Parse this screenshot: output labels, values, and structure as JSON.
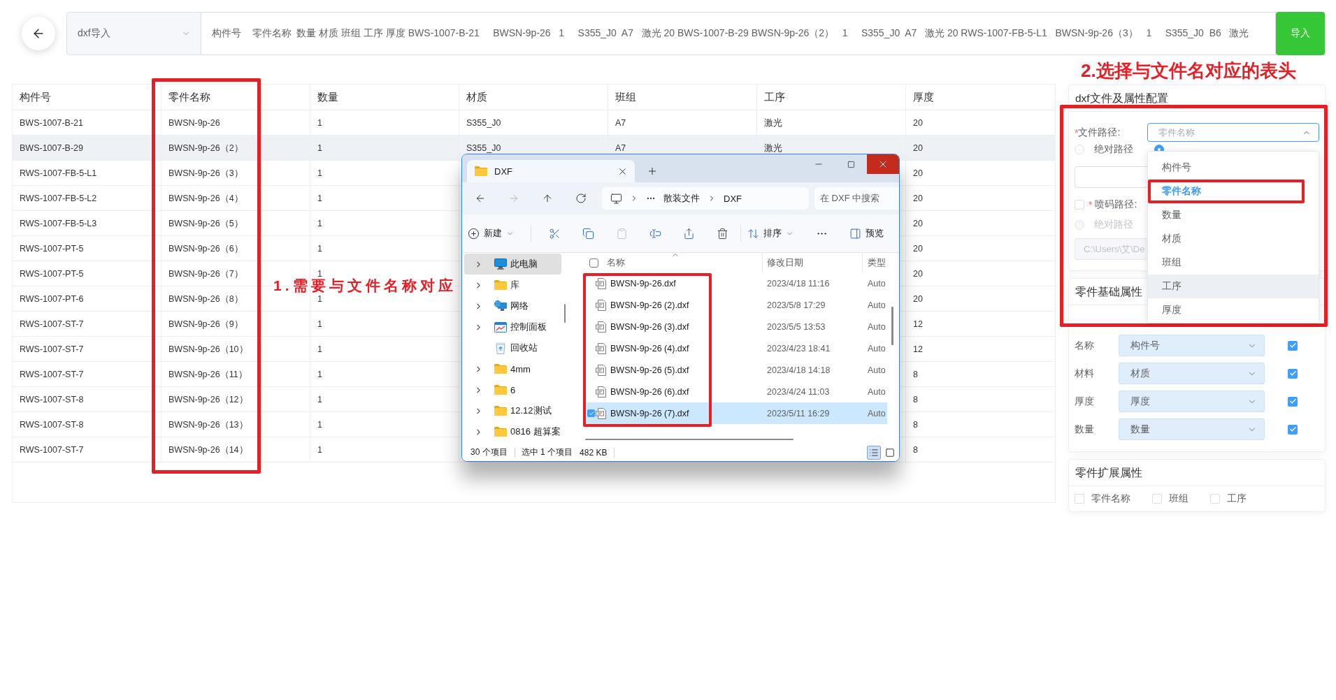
{
  "top_bar": {
    "import_type": {
      "value": "dxf导入"
    },
    "paste_field": {
      "value": "构件号    零件名称  数量 材质 班组 工序 厚度 BWS-1007-B-21     BWSN-9p-26   1     S355_J0  A7   激光 20 BWS-1007-B-29 BWSN-9p-26（2）   1     S355_J0  A7   激光 20 RWS-1007-FB-5-L1   BWSN-9p-26（3）   1     S355_J0  B6   激光"
    },
    "import_button": {
      "label": "导入"
    }
  },
  "annotations": [
    {
      "kind": "panel",
      "text": "2.选择与文件名对应的表头"
    },
    {
      "kind": "table",
      "text": "1.需要与文件名称对应"
    }
  ],
  "table": {
    "columns": [
      "构件号",
      "零件名称",
      "数量",
      "材质",
      "班组",
      "工序",
      "厚度"
    ],
    "rows": [
      {
        "hovered": false,
        "cells": {
          "component_no": "BWS-1007-B-21",
          "part_name": "BWSN-9p-26",
          "quantity": "1",
          "material": "S355_J0",
          "team": "A7",
          "process": "激光",
          "thickness": "20"
        }
      },
      {
        "hovered": true,
        "cells": {
          "component_no": "BWS-1007-B-29",
          "part_name": "BWSN-9p-26（2）",
          "quantity": "1",
          "material": "S355_J0",
          "team": "A7",
          "process": "激光",
          "thickness": "20"
        }
      },
      {
        "hovered": false,
        "cells": {
          "component_no": "RWS-1007-FB-5-L1",
          "part_name": "BWSN-9p-26（3）",
          "quantity": "1",
          "thickness": "20"
        }
      },
      {
        "hovered": false,
        "cells": {
          "component_no": "RWS-1007-FB-5-L2",
          "part_name": "BWSN-9p-26（4）",
          "quantity": "1",
          "thickness": "20"
        }
      },
      {
        "hovered": false,
        "cells": {
          "component_no": "RWS-1007-FB-5-L3",
          "part_name": "BWSN-9p-26（5）",
          "quantity": "1",
          "thickness": "20"
        }
      },
      {
        "hovered": false,
        "cells": {
          "component_no": "RWS-1007-PT-5",
          "part_name": "BWSN-9p-26（6）",
          "quantity": "1",
          "thickness": "20"
        }
      },
      {
        "hovered": false,
        "cells": {
          "component_no": "RWS-1007-PT-5",
          "part_name": "BWSN-9p-26（7）",
          "quantity": "1",
          "thickness": "20"
        }
      },
      {
        "hovered": false,
        "cells": {
          "component_no": "RWS-1007-PT-6",
          "part_name": "BWSN-9p-26（8）",
          "quantity": "1",
          "thickness": "20"
        }
      },
      {
        "hovered": false,
        "cells": {
          "component_no": "RWS-1007-ST-7",
          "part_name": "BWSN-9p-26（9）",
          "quantity": "1",
          "thickness": "12"
        }
      },
      {
        "hovered": false,
        "cells": {
          "component_no": "RWS-1007-ST-7",
          "part_name": "BWSN-9p-26（10）",
          "quantity": "1",
          "thickness": "12"
        }
      },
      {
        "hovered": false,
        "cells": {
          "component_no": "RWS-1007-ST-7",
          "part_name": "BWSN-9p-26（11）",
          "quantity": "1",
          "thickness": "8"
        }
      },
      {
        "hovered": false,
        "cells": {
          "component_no": "RWS-1007-ST-8",
          "part_name": "BWSN-9p-26（12）",
          "quantity": "1",
          "thickness": "8"
        }
      },
      {
        "hovered": false,
        "cells": {
          "component_no": "RWS-1007-ST-8",
          "part_name": "BWSN-9p-26（13）",
          "quantity": "1",
          "thickness": "8"
        }
      },
      {
        "hovered": false,
        "cells": {
          "component_no": "RWS-1007-ST-7",
          "part_name": "BWSN-9p-26（14）",
          "quantity": "1",
          "thickness": "8"
        }
      }
    ]
  },
  "file_explorer": {
    "tabs": [
      {
        "label": "DXF",
        "selected": true
      }
    ],
    "nav_buttons": [
      {
        "kind": "back",
        "disabled": false
      },
      {
        "kind": "forward",
        "disabled": true
      },
      {
        "kind": "up",
        "disabled": false
      },
      {
        "kind": "refresh",
        "disabled": false
      }
    ],
    "breadcrumb": [
      "散装文件",
      "DXF"
    ],
    "search": {
      "placeholder": "在 DXF 中搜索"
    },
    "commands": [
      {
        "kind": "new",
        "label": "新建",
        "disabled": false
      },
      {
        "kind": "cut",
        "disabled": false
      },
      {
        "kind": "copy",
        "disabled": false
      },
      {
        "kind": "paste",
        "disabled": true
      },
      {
        "kind": "rename",
        "disabled": false
      },
      {
        "kind": "share",
        "disabled": false
      },
      {
        "kind": "delete",
        "disabled": false
      },
      {
        "kind": "sort",
        "label": "排序",
        "disabled": false
      },
      {
        "kind": "more",
        "disabled": false
      },
      {
        "kind": "preview",
        "label": "预览",
        "disabled": false
      }
    ],
    "nav_pane": [
      {
        "kind": "computer",
        "label": "此电脑",
        "expandable": true,
        "selected": true
      },
      {
        "kind": "folder",
        "label": "库",
        "expandable": true,
        "selected": false
      },
      {
        "kind": "network",
        "label": "网络",
        "expandable": true,
        "selected": false
      },
      {
        "kind": "control_panel",
        "label": "控制面板",
        "expandable": true,
        "selected": false
      },
      {
        "kind": "recycle_bin",
        "label": "回收站",
        "expandable": false,
        "selected": false
      },
      {
        "kind": "folder",
        "label": "4mm",
        "expandable": true,
        "selected": false
      },
      {
        "kind": "folder",
        "label": "6",
        "expandable": true,
        "selected": false
      },
      {
        "kind": "folder",
        "label": "12.12测试",
        "expandable": true,
        "selected": false
      },
      {
        "kind": "folder",
        "label": "0816 超算案",
        "expandable": true,
        "selected": false
      }
    ],
    "select_all": {
      "checked": false
    },
    "columns": [
      "名称",
      "修改日期",
      "类型"
    ],
    "files": [
      {
        "name": "BWSN-9p-26.dxf",
        "modified": "2023/4/18 11:16",
        "type": "Auto",
        "selected": false
      },
      {
        "name": "BWSN-9p-26 (2).dxf",
        "modified": "2023/5/8 17:29",
        "type": "Auto",
        "selected": false
      },
      {
        "name": "BWSN-9p-26 (3).dxf",
        "modified": "2023/5/5 13:53",
        "type": "Auto",
        "selected": false
      },
      {
        "name": "BWSN-9p-26 (4).dxf",
        "modified": "2023/4/23 18:41",
        "type": "Auto",
        "selected": false
      },
      {
        "name": "BWSN-9p-26 (5).dxf",
        "modified": "2023/4/18 14:18",
        "type": "Auto",
        "selected": false
      },
      {
        "name": "BWSN-9p-26 (6).dxf",
        "modified": "2023/4/24 11:03",
        "type": "Auto",
        "selected": false
      },
      {
        "name": "BWSN-9p-26 (7).dxf",
        "modified": "2023/5/11 16:29",
        "type": "Auto",
        "selected": true
      }
    ],
    "status": {
      "item_count": "30 个项目",
      "selection": "选中 1 个项目",
      "size": "482 KB"
    },
    "view_modes": [
      {
        "kind": "details",
        "selected": true
      },
      {
        "kind": "large_icons",
        "selected": false
      }
    ]
  },
  "config_panel": {
    "title": "dxf文件及属性配置",
    "file_path": {
      "required_mark": "*",
      "label": "文件路径:",
      "placeholder": "零件名称",
      "expanded": true,
      "options": [
        {
          "label": "构件号",
          "selected": false,
          "hovered": false
        },
        {
          "label": "零件名称",
          "selected": true,
          "hovered": false
        },
        {
          "label": "数量",
          "selected": false,
          "hovered": false
        },
        {
          "label": "材质",
          "selected": false,
          "hovered": false
        },
        {
          "label": "班组",
          "selected": false,
          "hovered": false
        },
        {
          "label": "工序",
          "selected": false,
          "hovered": true
        },
        {
          "label": "厚度",
          "selected": false,
          "hovered": false
        }
      ]
    },
    "path_modes": [
      {
        "label": "绝对路径",
        "selected": false
      },
      {
        "selected": true
      }
    ],
    "spray_path": {
      "checked": false,
      "required_mark": "*",
      "label": "喷码路径:"
    },
    "spray_modes": [
      {
        "label": "绝对路径",
        "selected": false,
        "disabled": true
      }
    ],
    "spray_input": {
      "value": "C:\\Users\\艾\\De",
      "disabled": true
    }
  },
  "basic_attributes": {
    "title": "零件基础属性",
    "rows": [
      {
        "label": "名称",
        "value": "构件号",
        "checked": true
      },
      {
        "label": "材料",
        "value": "材质",
        "checked": true
      },
      {
        "label": "厚度",
        "value": "厚度",
        "checked": true
      },
      {
        "label": "数量",
        "value": "数量",
        "checked": true
      }
    ]
  },
  "extended_attributes": {
    "title": "零件扩展属性",
    "options": [
      {
        "label": "零件名称",
        "checked": false
      },
      {
        "label": "班组",
        "checked": false
      },
      {
        "label": "工序",
        "checked": false
      }
    ]
  }
}
